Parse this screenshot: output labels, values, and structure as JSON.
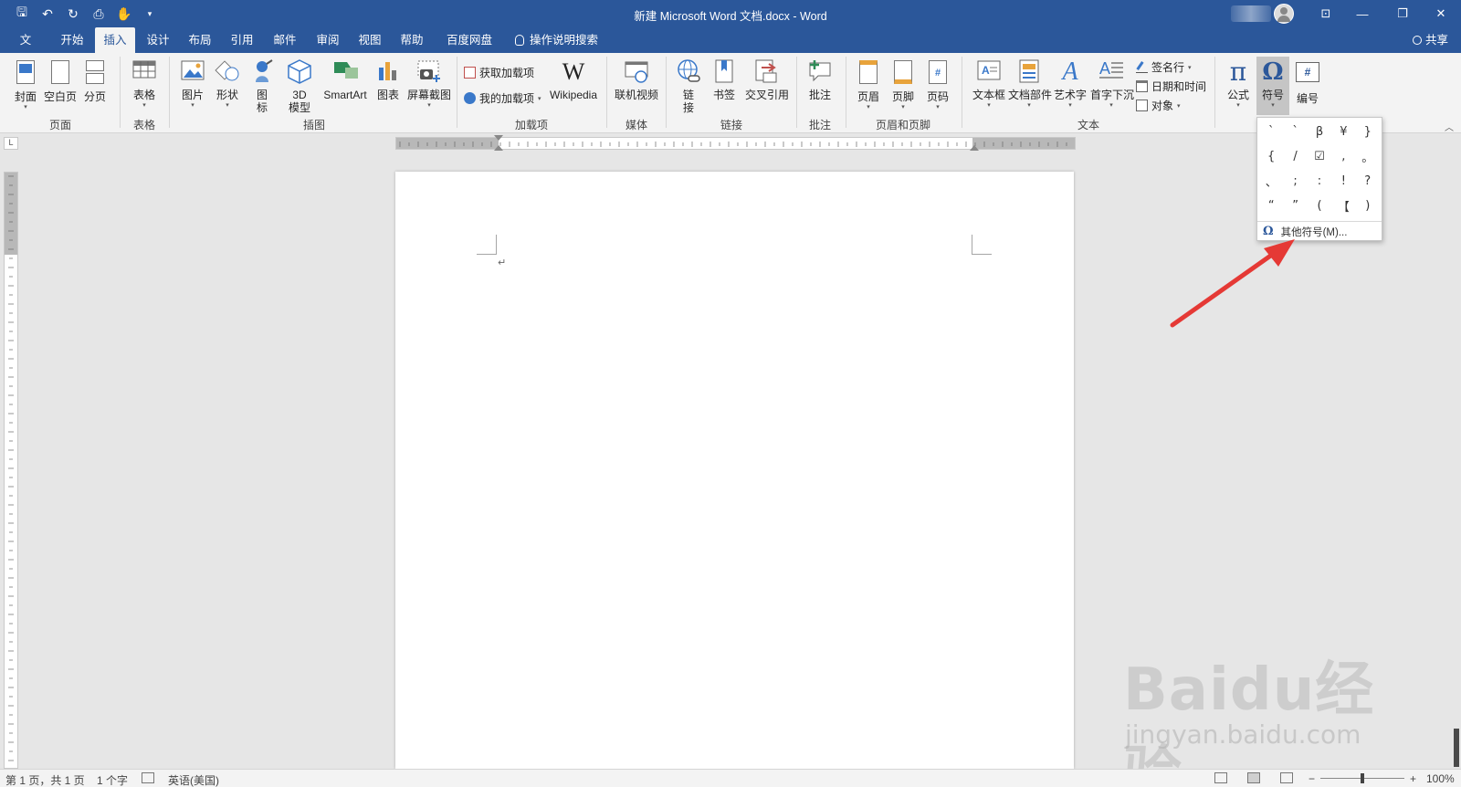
{
  "window": {
    "title": "新建 Microsoft Word 文档.docx  -  Word",
    "share_label": "共享",
    "minimize_glyph": "—",
    "restore_glyph": "❐",
    "close_glyph": "✕",
    "ribbon_display_glyph": "⊡"
  },
  "qat": {
    "save_glyph": "🖫",
    "undo_glyph": "↶",
    "redo_glyph": "↻",
    "preview_glyph": "⎙",
    "touch_glyph": "✋",
    "customize_glyph": "▾"
  },
  "tabs": [
    {
      "label": "文件"
    },
    {
      "label": "开始"
    },
    {
      "label": "插入"
    },
    {
      "label": "设计"
    },
    {
      "label": "布局"
    },
    {
      "label": "引用"
    },
    {
      "label": "邮件"
    },
    {
      "label": "审阅"
    },
    {
      "label": "视图"
    },
    {
      "label": "帮助"
    },
    {
      "label": "百度网盘"
    },
    {
      "label": "操作说明搜索"
    }
  ],
  "ribbon": {
    "pages": {
      "cover": "封面",
      "blank": "空白页",
      "break": "分页",
      "group": "页面"
    },
    "tables": {
      "table": "表格",
      "group": "表格"
    },
    "illustrations": {
      "picture": "图片",
      "shapes": "形状",
      "icons": "图\n标",
      "model3d": "3D\n模型",
      "smartart": "SmartArt",
      "chart": "图表",
      "screenshot": "屏幕截图",
      "group": "插图"
    },
    "addins": {
      "get": "获取加载项",
      "my": "我的加载项",
      "wikipedia": "Wikipedia",
      "wiki_glyph": "W",
      "group": "加载项"
    },
    "media": {
      "video": "联机视频",
      "group": "媒体"
    },
    "links": {
      "link": "链\n接",
      "bookmark": "书签",
      "crossref": "交叉引用",
      "group": "链接"
    },
    "comments": {
      "comment": "批注",
      "group": "批注"
    },
    "headerfooter": {
      "header": "页眉",
      "footer": "页脚",
      "pagenum": "页码",
      "group": "页眉和页脚"
    },
    "text": {
      "textbox": "文本框",
      "quickparts": "文档部件",
      "wordart": "艺术字",
      "dropcap": "首字下沉",
      "signature": "签名行",
      "datetime": "日期和时间",
      "object": "对象",
      "group": "文本"
    },
    "symbols": {
      "equation": "公式",
      "equation_glyph": "π",
      "symbol": "符号",
      "symbol_glyph": "Ω",
      "number": "编号",
      "number_glyph": "#"
    }
  },
  "symbol_menu": {
    "symbols": [
      "`",
      "`",
      "β",
      "¥",
      "}",
      "{",
      "/",
      "☑",
      ",",
      "。",
      "、",
      ";",
      ":",
      "!",
      "?",
      "“",
      "”",
      "(",
      "【",
      ")"
    ],
    "more_label": "其他符号(M)...",
    "more_glyph": "Ω"
  },
  "document": {
    "paragraph_mark": "↵"
  },
  "status": {
    "page": "第 1 页，共 1 页",
    "words": "1 个字",
    "language": "英语(美国)",
    "zoom": "100%",
    "zoom_minus": "−",
    "zoom_plus": "+"
  },
  "watermark": {
    "brand": "Baidu经验",
    "url": "jingyan.baidu.com"
  },
  "colors": {
    "title_bar": "#2b579a",
    "ribbon_bg": "#f3f3f3",
    "arrow": "#e53935"
  }
}
